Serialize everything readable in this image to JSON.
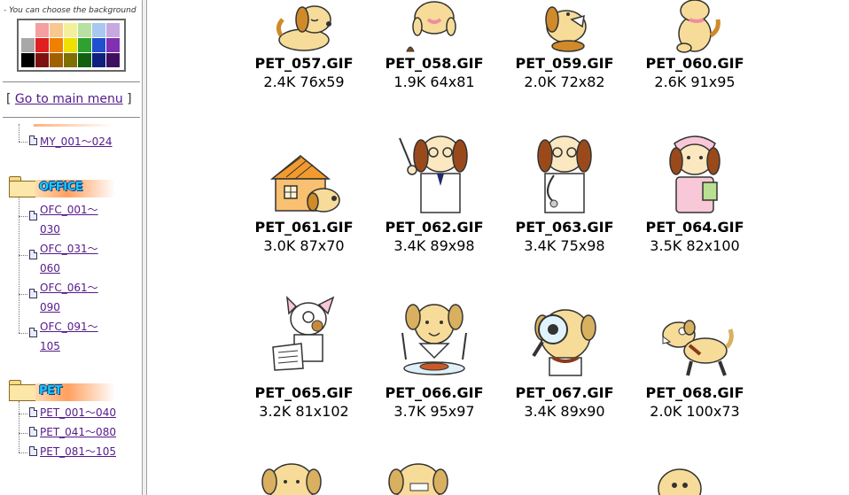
{
  "sidebar": {
    "bg_caption": "- You can choose the background",
    "palette_colors": [
      "#ffffff",
      "#f4a0a0",
      "#f8c890",
      "#f4f09a",
      "#b8e0a0",
      "#a8c8f0",
      "#c8a8e0",
      "#a8a8a8",
      "#e02020",
      "#f08000",
      "#f0e000",
      "#30a030",
      "#2050d0",
      "#8030b0",
      "#000000",
      "#801010",
      "#a06000",
      "#807000",
      "#106010",
      "#102080",
      "#401060"
    ],
    "main_menu": {
      "bracket_open": "[",
      "label": "Go to main menu",
      "bracket_close": "]"
    },
    "prev_item": "MY_001～024",
    "categories": [
      {
        "title": "OFFICE",
        "items": [
          {
            "line1": "OFC_001～",
            "line2": "030"
          },
          {
            "line1": "OFC_031～",
            "line2": "060"
          },
          {
            "line1": "OFC_061～",
            "line2": "090"
          },
          {
            "line1": "OFC_091～",
            "line2": "105"
          }
        ]
      },
      {
        "title": "PET",
        "items": [
          {
            "line1": "PET_001～040"
          },
          {
            "line1": "PET_041～080"
          },
          {
            "line1": "PET_081～105"
          }
        ]
      }
    ]
  },
  "gallery": {
    "items": [
      {
        "name": "PET_057.GIF",
        "meta": "2.4K 76x59",
        "icon": "sleepy-dog-icon"
      },
      {
        "name": "PET_058.GIF",
        "meta": "1.9K 64x81",
        "icon": "dog-poop-icon"
      },
      {
        "name": "PET_059.GIF",
        "meta": "2.0K 72x82",
        "icon": "howling-dog-icon"
      },
      {
        "name": "PET_060.GIF",
        "meta": "2.6K 91x95",
        "icon": "sitting-dog-icon"
      },
      {
        "name": "PET_061.GIF",
        "meta": "3.0K 87x70",
        "icon": "dog-house-icon"
      },
      {
        "name": "PET_062.GIF",
        "meta": "3.4K 89x98",
        "icon": "professor-dog-icon"
      },
      {
        "name": "PET_063.GIF",
        "meta": "3.4K 75x98",
        "icon": "doctor-dog-icon"
      },
      {
        "name": "PET_064.GIF",
        "meta": "3.5K 82x100",
        "icon": "nurse-dog-icon"
      },
      {
        "name": "PET_065.GIF",
        "meta": "3.2K 81x102",
        "icon": "newspaper-dog-icon"
      },
      {
        "name": "PET_066.GIF",
        "meta": "3.7K 95x97",
        "icon": "dining-dog-icon"
      },
      {
        "name": "PET_067.GIF",
        "meta": "3.4K 89x90",
        "icon": "magnifier-dog-icon"
      },
      {
        "name": "PET_068.GIF",
        "meta": "2.0K 100x73",
        "icon": "barking-dog-icon"
      }
    ]
  }
}
